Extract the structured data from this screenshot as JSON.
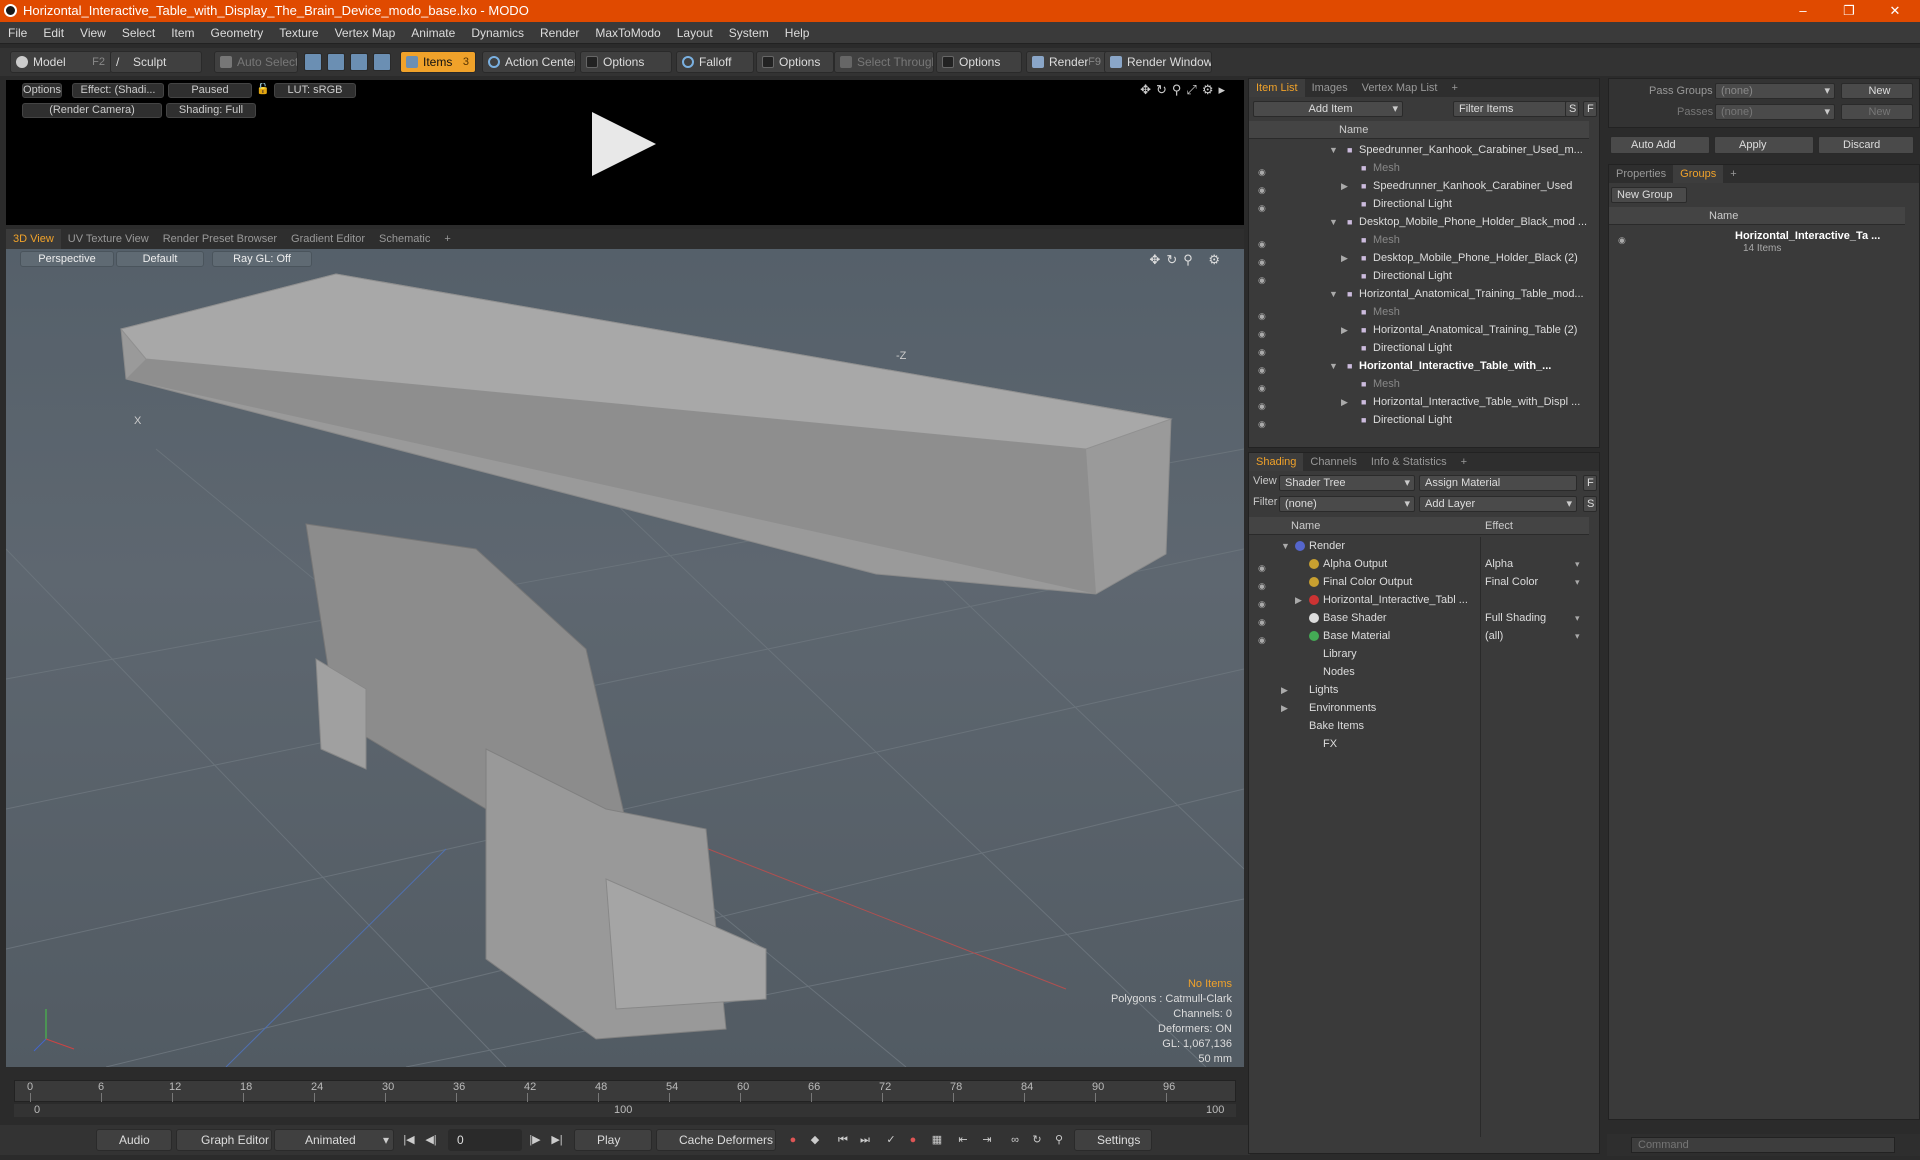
{
  "window": {
    "title": "Horizontal_Interactive_Table_with_Display_The_Brain_Device_modo_base.lxo - MODO"
  },
  "menu": [
    "File",
    "Edit",
    "View",
    "Select",
    "Item",
    "Geometry",
    "Texture",
    "Vertex Map",
    "Animate",
    "Dynamics",
    "Render",
    "MaxToModo",
    "Layout",
    "System",
    "Help"
  ],
  "toolbar": {
    "model": "Model",
    "model_key": "F2",
    "sculpt": "Sculpt",
    "auto_select": "Auto Select",
    "items": "Items",
    "items_key": "3",
    "action_center": "Action Center",
    "options1": "Options",
    "falloff": "Falloff",
    "options2": "Options",
    "select_through": "Select Through",
    "options3": "Options",
    "render": "Render",
    "render_key": "F9",
    "render_window": "Render Window"
  },
  "preview": {
    "options": "Options",
    "effect": "Effect: (Shadi...",
    "paused": "Paused",
    "lut": "LUT: sRGB",
    "camera": "(Render Camera)",
    "shading": "Shading: Full"
  },
  "view_tabs": [
    "3D View",
    "UV Texture View",
    "Render Preset Browser",
    "Gradient Editor",
    "Schematic",
    "+"
  ],
  "viewport": {
    "perspective": "Perspective",
    "default": "Default",
    "raygl": "Ray GL: Off",
    "axis_z": "-Z",
    "axis_x": "X"
  },
  "stats": {
    "items": "No Items",
    "polygons": "Polygons : Catmull-Clark",
    "channels": "Channels: 0",
    "deformers": "Deformers: ON",
    "gl": "GL: 1,067,136",
    "focal": "50 mm"
  },
  "timeline": {
    "ticks": [
      "0",
      "6",
      "12",
      "18",
      "24",
      "30",
      "36",
      "42",
      "48",
      "54",
      "60",
      "66",
      "72",
      "78",
      "84",
      "90",
      "96"
    ],
    "sub": [
      "0",
      "100",
      "100"
    ]
  },
  "bottombar": {
    "audio": "Audio",
    "graph_editor": "Graph Editor",
    "animated": "Animated",
    "frame": "0",
    "play": "Play",
    "cache": "Cache Deformers",
    "settings": "Settings"
  },
  "item_list": {
    "tabs": [
      "Item List",
      "Images",
      "Vertex Map List",
      "+"
    ],
    "add_item": "Add Item",
    "filter_items": "Filter Items",
    "s": "S",
    "f": "F",
    "col_name": "Name",
    "rows": [
      {
        "label": "Speedrunner_Kanhook_Carabiner_Used_m...",
        "indent": 0,
        "tri": "▼",
        "dim": false,
        "bold": false
      },
      {
        "label": "Mesh",
        "indent": 1,
        "tri": "",
        "dim": true,
        "bold": false
      },
      {
        "label": "Speedrunner_Kanhook_Carabiner_Used",
        "indent": 1,
        "tri": "▶",
        "dim": false,
        "bold": false
      },
      {
        "label": "Directional Light",
        "indent": 1,
        "tri": "",
        "dim": false,
        "bold": false
      },
      {
        "label": "Desktop_Mobile_Phone_Holder_Black_mod ...",
        "indent": 0,
        "tri": "▼",
        "dim": false,
        "bold": false
      },
      {
        "label": "Mesh",
        "indent": 1,
        "tri": "",
        "dim": true,
        "bold": false
      },
      {
        "label": "Desktop_Mobile_Phone_Holder_Black (2)",
        "indent": 1,
        "tri": "▶",
        "dim": false,
        "bold": false
      },
      {
        "label": "Directional Light",
        "indent": 1,
        "tri": "",
        "dim": false,
        "bold": false
      },
      {
        "label": "Horizontal_Anatomical_Training_Table_mod...",
        "indent": 0,
        "tri": "▼",
        "dim": false,
        "bold": false
      },
      {
        "label": "Mesh",
        "indent": 1,
        "tri": "",
        "dim": true,
        "bold": false
      },
      {
        "label": "Horizontal_Anatomical_Training_Table (2)",
        "indent": 1,
        "tri": "▶",
        "dim": false,
        "bold": false
      },
      {
        "label": "Directional Light",
        "indent": 1,
        "tri": "",
        "dim": false,
        "bold": false
      },
      {
        "label": "Horizontal_Interactive_Table_with_...",
        "indent": 0,
        "tri": "▼",
        "dim": false,
        "bold": true
      },
      {
        "label": "Mesh",
        "indent": 1,
        "tri": "",
        "dim": true,
        "bold": false
      },
      {
        "label": "Horizontal_Interactive_Table_with_Displ ...",
        "indent": 1,
        "tri": "▶",
        "dim": false,
        "bold": false
      },
      {
        "label": "Directional Light",
        "indent": 1,
        "tri": "",
        "dim": false,
        "bold": false
      }
    ]
  },
  "shading": {
    "tabs": [
      "Shading",
      "Channels",
      "Info & Statistics",
      "+"
    ],
    "view_label": "View",
    "view_value": "Shader Tree",
    "assign_material": "Assign Material",
    "f": "F",
    "filter_label": "Filter",
    "filter_value": "(none)",
    "add_layer": "Add Layer",
    "s": "S",
    "col_name": "Name",
    "col_effect": "Effect",
    "rows": [
      {
        "label": "Render",
        "effect": "",
        "indent": 0,
        "tri": "▼",
        "eye": false,
        "swatch": "#5566cc"
      },
      {
        "label": "Alpha Output",
        "effect": "Alpha",
        "indent": 1,
        "tri": "",
        "eye": true,
        "swatch": "#c8a030"
      },
      {
        "label": "Final Color Output",
        "effect": "Final Color",
        "indent": 1,
        "tri": "",
        "eye": true,
        "swatch": "#c8a030"
      },
      {
        "label": "Horizontal_Interactive_Tabl ...",
        "effect": "",
        "indent": 1,
        "tri": "▶",
        "eye": true,
        "swatch": "#cc3333"
      },
      {
        "label": "Base Shader",
        "effect": "Full Shading",
        "indent": 1,
        "tri": "",
        "eye": true,
        "swatch": "#dddddd"
      },
      {
        "label": "Base Material",
        "effect": "(all)",
        "indent": 1,
        "tri": "",
        "eye": true,
        "swatch": "#44aa55"
      },
      {
        "label": "Library",
        "effect": "",
        "indent": 1,
        "tri": "",
        "eye": false,
        "swatch": ""
      },
      {
        "label": "Nodes",
        "effect": "",
        "indent": 1,
        "tri": "",
        "eye": false,
        "swatch": ""
      },
      {
        "label": "Lights",
        "effect": "",
        "indent": 0,
        "tri": "▶",
        "eye": false,
        "swatch": ""
      },
      {
        "label": "Environments",
        "effect": "",
        "indent": 0,
        "tri": "▶",
        "eye": false,
        "swatch": ""
      },
      {
        "label": "Bake Items",
        "effect": "",
        "indent": 0,
        "tri": "",
        "eye": false,
        "swatch": ""
      },
      {
        "label": "FX",
        "effect": "",
        "indent": 1,
        "tri": "",
        "eye": false,
        "swatch": ""
      }
    ]
  },
  "passes": {
    "pass_groups": "Pass Groups",
    "pass_value": "(none)",
    "new1": "New",
    "passes": "Passes",
    "passes_value": "(none)",
    "new2": "New"
  },
  "actions": {
    "auto_add": "Auto Add",
    "apply": "Apply",
    "discard": "Discard"
  },
  "groups": {
    "tabs": [
      "Properties",
      "Groups",
      "+"
    ],
    "new_group": "New Group",
    "col_name": "Name",
    "group_name": "Horizontal_Interactive_Ta ...",
    "group_count": "14 Items"
  },
  "command": {
    "placeholder": "Command"
  }
}
